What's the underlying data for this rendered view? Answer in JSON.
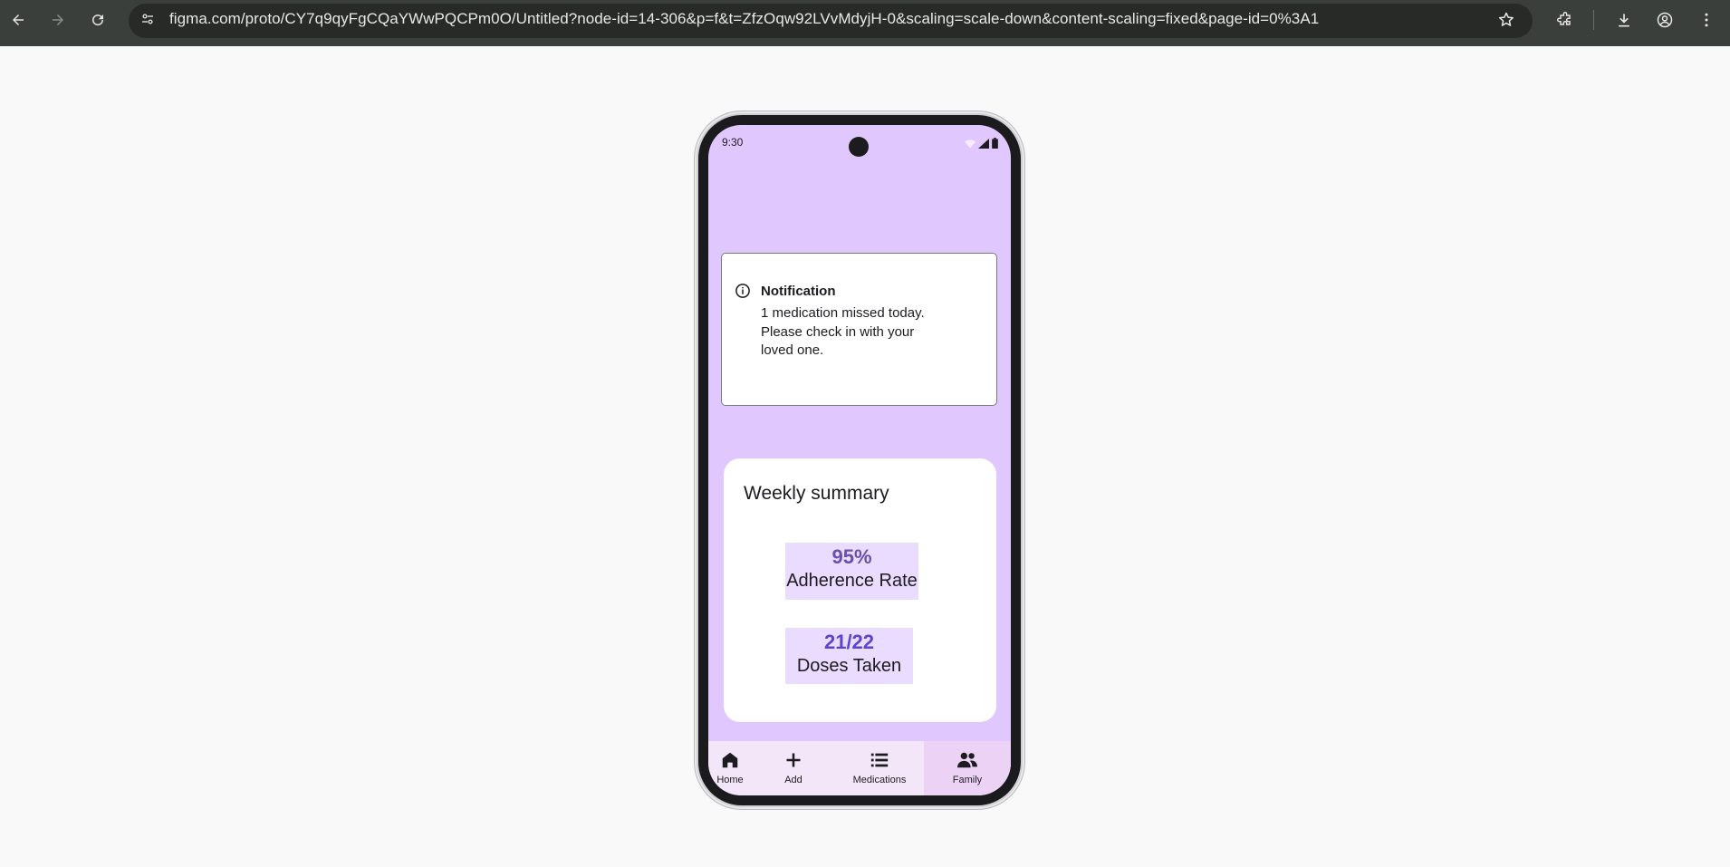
{
  "browser": {
    "url": "figma.com/proto/CY7q9qyFgCQaYWwPQCPm0O/Untitled?node-id=14-306&p=f&t=ZfzOqw92LVvMdyjH-0&scaling=scale-down&content-scaling=fixed&page-id=0%3A1"
  },
  "status_bar": {
    "time": "9:30"
  },
  "notification": {
    "title": "Notification",
    "line1": "1 medication missed today.",
    "line2": "Please check in with your",
    "line3": "loved one."
  },
  "summary": {
    "title": "Weekly summary",
    "adherence": {
      "value": "95%",
      "label": "Adherence Rate"
    },
    "doses": {
      "value": "21/22",
      "label": "Doses Taken"
    }
  },
  "nav": {
    "items": [
      {
        "label": "Home",
        "icon": "home-icon"
      },
      {
        "label": "Add",
        "icon": "plus-icon"
      },
      {
        "label": "Medications",
        "icon": "list-icon"
      },
      {
        "label": "Family",
        "icon": "family-icon"
      }
    ],
    "active": "Family"
  },
  "colors": {
    "screen_bg": "#e0c8ff",
    "stat_bg": "#e9dcff",
    "nav_bg": "#f2e6f8",
    "nav_active": "#ecd3f6"
  }
}
